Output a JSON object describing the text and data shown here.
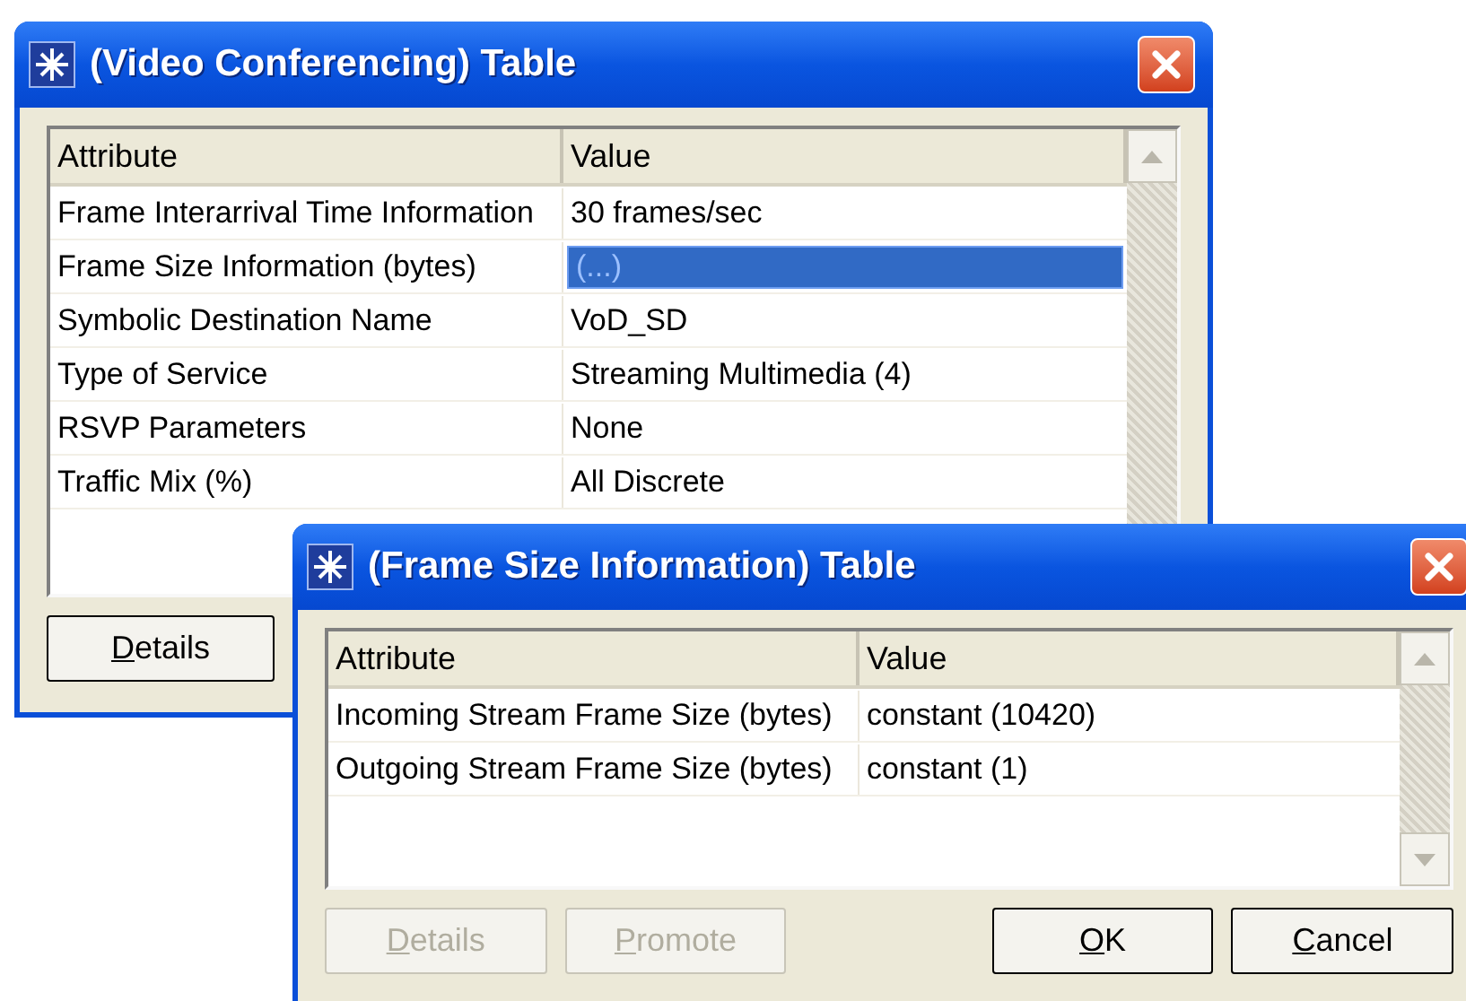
{
  "windows": [
    {
      "title": "(Video Conferencing) Table",
      "columns": [
        "Attribute",
        "Value"
      ],
      "rows": [
        {
          "attribute": "Frame Interarrival Time Information",
          "value": "30 frames/sec",
          "selected": false
        },
        {
          "attribute": "Frame Size Information (bytes)",
          "value": "(...)",
          "selected": true
        },
        {
          "attribute": "Symbolic Destination Name",
          "value": "VoD_SD",
          "selected": false
        },
        {
          "attribute": "Type of Service",
          "value": "Streaming Multimedia (4)",
          "selected": false
        },
        {
          "attribute": "RSVP Parameters",
          "value": "None",
          "selected": false
        },
        {
          "attribute": "Traffic Mix (%)",
          "value": "All Discrete",
          "selected": false
        }
      ],
      "buttons": [
        {
          "label": "Details",
          "disabled": false
        }
      ]
    },
    {
      "title": "(Frame Size Information) Table",
      "columns": [
        "Attribute",
        "Value"
      ],
      "rows": [
        {
          "attribute": "Incoming Stream Frame Size (bytes)",
          "value": "constant (10420)",
          "selected": false
        },
        {
          "attribute": "Outgoing Stream Frame Size (bytes)",
          "value": "constant (1)",
          "selected": false
        }
      ],
      "buttons": [
        {
          "label": "Details",
          "disabled": true
        },
        {
          "label": "Promote",
          "disabled": true
        },
        {
          "label": "OK",
          "disabled": false
        },
        {
          "label": "Cancel",
          "disabled": false
        }
      ]
    }
  ]
}
